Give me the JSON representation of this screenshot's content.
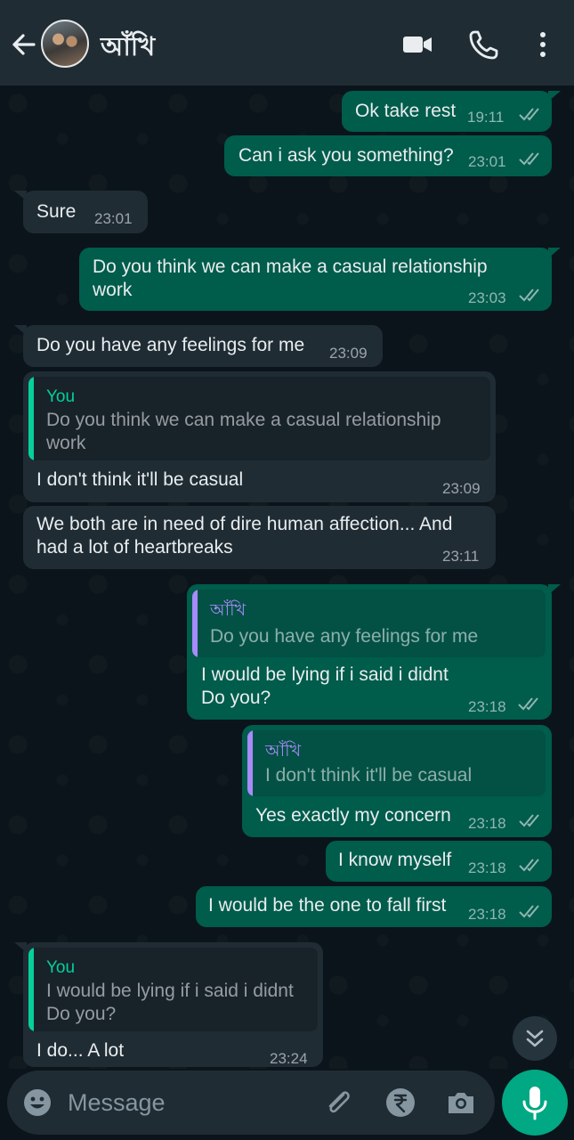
{
  "header": {
    "contact_name": "আঁখি"
  },
  "colors": {
    "outgoing_bubble": "#005c4b",
    "incoming_bubble": "#1f2c34",
    "quote_you": "#06cf9c",
    "quote_contact": "#a78bfa",
    "accent": "#00a884"
  },
  "messages": [
    {
      "dir": "out",
      "text": "Ok take rest",
      "time": "19:11",
      "read": true
    },
    {
      "dir": "out",
      "text": "Can i ask you something?",
      "time": "23:01",
      "read": true
    },
    {
      "dir": "in",
      "text": "Sure",
      "time": "23:01"
    },
    {
      "dir": "out",
      "text": "Do you think we can make a casual relationship\nwork",
      "time": "23:03",
      "read": true
    },
    {
      "dir": "in",
      "text": "Do you have any feelings for me",
      "time": "23:09"
    },
    {
      "dir": "in",
      "quote": {
        "name": "You",
        "text": "Do you think we can make a casual relationship\nwork"
      },
      "text": "I don't think it'll be casual",
      "time": "23:09"
    },
    {
      "dir": "in",
      "text": "We both are in need of dire human affection... And\nhad a lot of heartbreaks",
      "time": "23:11"
    },
    {
      "dir": "out",
      "quote": {
        "name": "আঁখি",
        "text": "Do you have any feelings for me"
      },
      "text": "I would be lying if i said i didnt\nDo you?",
      "time": "23:18",
      "read": true
    },
    {
      "dir": "out",
      "quote": {
        "name": "আঁখি",
        "text": "I don't think it'll be casual"
      },
      "text": "Yes exactly my concern",
      "time": "23:18",
      "read": true
    },
    {
      "dir": "out",
      "text": "I know myself",
      "time": "23:18",
      "read": true
    },
    {
      "dir": "out",
      "text": "I would be the one to fall first",
      "time": "23:18",
      "read": true
    },
    {
      "dir": "in",
      "quote": {
        "name": "You",
        "text": "I would be lying if i said i didnt\nDo you?"
      },
      "text": "I do... A lot",
      "time": "23:24"
    }
  ],
  "input": {
    "placeholder": "Message",
    "value": ""
  },
  "icons": {
    "back": "arrow-left-icon",
    "video": "video-camera-icon",
    "call": "phone-icon",
    "menu": "more-vertical-icon",
    "emoji": "emoji-icon",
    "attach": "paperclip-icon",
    "payment": "rupee-icon",
    "camera": "camera-icon",
    "mic": "microphone-icon",
    "scroll": "double-chevron-down-icon"
  }
}
